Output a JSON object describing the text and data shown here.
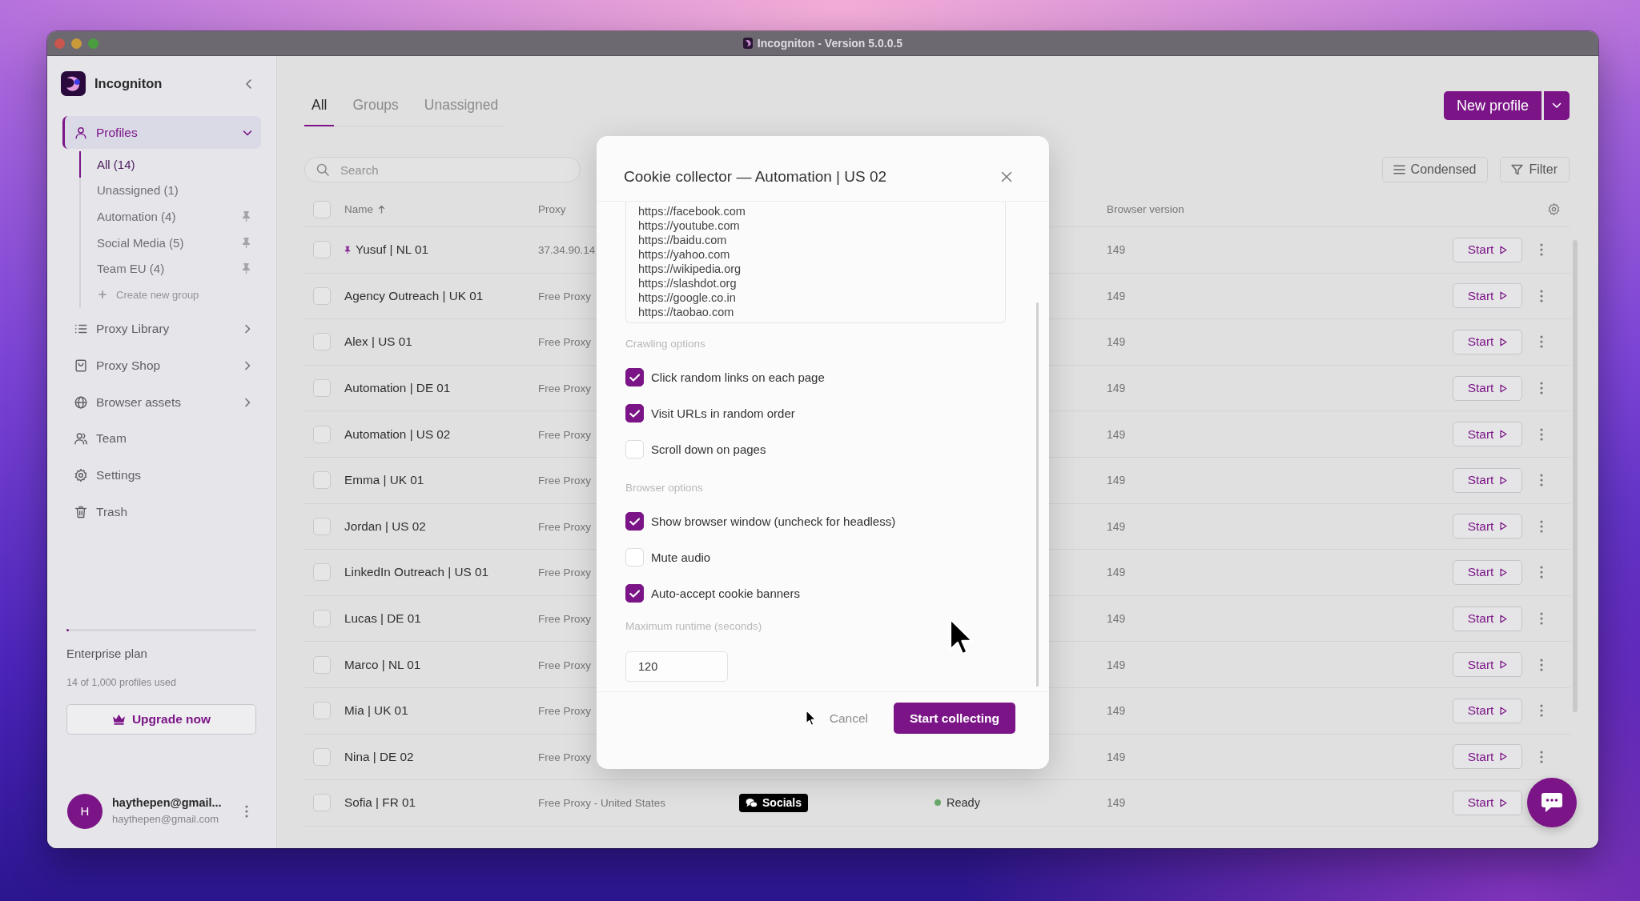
{
  "window": {
    "title": "Incogniton - Version 5.0.0.5"
  },
  "sidebar": {
    "app_name": "Incogniton",
    "nav": [
      {
        "label": "Profiles",
        "selected": true,
        "expanded": true,
        "children": [
          {
            "label": "All (14)",
            "selected": true,
            "pinned": false
          },
          {
            "label": "Unassigned (1)",
            "selected": false,
            "pinned": false
          },
          {
            "label": "Automation (4)",
            "selected": false,
            "pinned": true
          },
          {
            "label": "Social Media (5)",
            "selected": false,
            "pinned": true
          },
          {
            "label": "Team EU (4)",
            "selected": false,
            "pinned": true
          }
        ],
        "add_label": "Create new group"
      },
      {
        "label": "Proxy Library",
        "selected": false,
        "expanded": false
      },
      {
        "label": "Proxy Shop",
        "selected": false,
        "expanded": false
      },
      {
        "label": "Browser assets",
        "selected": false,
        "expanded": false
      },
      {
        "label": "Team",
        "selected": false
      },
      {
        "label": "Settings",
        "selected": false
      },
      {
        "label": "Trash",
        "selected": false
      }
    ],
    "plan": {
      "level": 0.014,
      "name": "Enterprise plan",
      "usage": "14 of 1,000 profiles used"
    },
    "upgrade_label": "Upgrade now",
    "user": {
      "initial": "H",
      "name": "haythepen@gmail...",
      "email": "haythepen@gmail.com"
    }
  },
  "tabs": [
    {
      "label": "All",
      "selected": true
    },
    {
      "label": "Groups",
      "selected": false
    },
    {
      "label": "Unassigned",
      "selected": false
    }
  ],
  "toolbar": {
    "new_profile_label": "New profile",
    "search": {
      "placeholder": "Search"
    },
    "view_label": "Condensed",
    "filter_label": "Filter"
  },
  "table": {
    "select_all_checked": false,
    "columns": [
      {
        "label": "Name",
        "sorted": true
      },
      {
        "label": "Proxy",
        "sorted": false
      },
      {
        "label": "Browser version",
        "sorted": false
      }
    ],
    "rows": [
      {
        "name": "Yusuf | NL 01",
        "pinned": true,
        "checked": false,
        "proxy": "37.34.90.14",
        "browser_version": "149",
        "start_label": "Start"
      },
      {
        "name": "Agency Outreach | UK 01",
        "pinned": false,
        "checked": false,
        "proxy": "Free Proxy",
        "browser_version": "149",
        "start_label": "Start"
      },
      {
        "name": "Alex | US 01",
        "pinned": false,
        "checked": false,
        "proxy": "Free Proxy",
        "browser_version": "149",
        "start_label": "Start"
      },
      {
        "name": "Automation | DE 01",
        "pinned": false,
        "checked": false,
        "proxy": "Free Proxy",
        "browser_version": "149",
        "start_label": "Start"
      },
      {
        "name": "Automation | US 02",
        "pinned": false,
        "checked": false,
        "proxy": "Free Proxy",
        "browser_version": "149",
        "start_label": "Start"
      },
      {
        "name": "Emma | UK 01",
        "pinned": false,
        "checked": false,
        "proxy": "Free Proxy",
        "browser_version": "149",
        "start_label": "Start"
      },
      {
        "name": "Jordan | US 02",
        "pinned": false,
        "checked": false,
        "proxy": "Free Proxy",
        "browser_version": "149",
        "start_label": "Start"
      },
      {
        "name": "LinkedIn Outreach | US 01",
        "pinned": false,
        "checked": false,
        "proxy": "Free Proxy",
        "browser_version": "149",
        "start_label": "Start"
      },
      {
        "name": "Lucas | DE 01",
        "pinned": false,
        "checked": false,
        "proxy": "Free Proxy",
        "browser_version": "149",
        "start_label": "Start"
      },
      {
        "name": "Marco | NL 01",
        "pinned": false,
        "checked": false,
        "proxy": "Free Proxy",
        "browser_version": "149",
        "start_label": "Start"
      },
      {
        "name": "Mia | UK 01",
        "pinned": false,
        "checked": false,
        "proxy": "Free Proxy",
        "browser_version": "149",
        "start_label": "Start"
      },
      {
        "name": "Nina | DE 02",
        "pinned": false,
        "checked": false,
        "proxy": "Free Proxy",
        "browser_version": "149",
        "start_label": "Start"
      },
      {
        "name": "Sofia | FR 01",
        "pinned": false,
        "checked": false,
        "proxy": "Free Proxy - United States",
        "tags": [
          {
            "label": "Socials",
            "color": "#000000"
          }
        ],
        "status": {
          "label": "Ready",
          "color": "#6aa86a"
        },
        "browser_version": "149",
        "start_label": "Start"
      }
    ]
  },
  "dialog": {
    "title": "Cookie collector — Automation | US 02",
    "urls": [
      "https://facebook.com",
      "https://youtube.com",
      "https://baidu.com",
      "https://yahoo.com",
      "https://wikipedia.org",
      "https://slashdot.org",
      "https://google.co.in",
      "https://taobao.com"
    ],
    "sections": [
      {
        "title": "Crawling options",
        "options": [
          {
            "label": "Click random links on each page",
            "checked": true
          },
          {
            "label": "Visit URLs in random order",
            "checked": true
          },
          {
            "label": "Scroll down on pages",
            "checked": false
          }
        ]
      },
      {
        "title": "Browser options",
        "options": [
          {
            "label": "Show browser window (uncheck for headless)",
            "checked": true
          },
          {
            "label": "Mute audio",
            "checked": false
          },
          {
            "label": "Auto-accept cookie banners",
            "checked": true
          }
        ]
      }
    ],
    "runtime": {
      "label": "Maximum runtime (seconds)",
      "value": "120"
    },
    "cancel_label": "Cancel",
    "submit_label": "Start collecting"
  }
}
